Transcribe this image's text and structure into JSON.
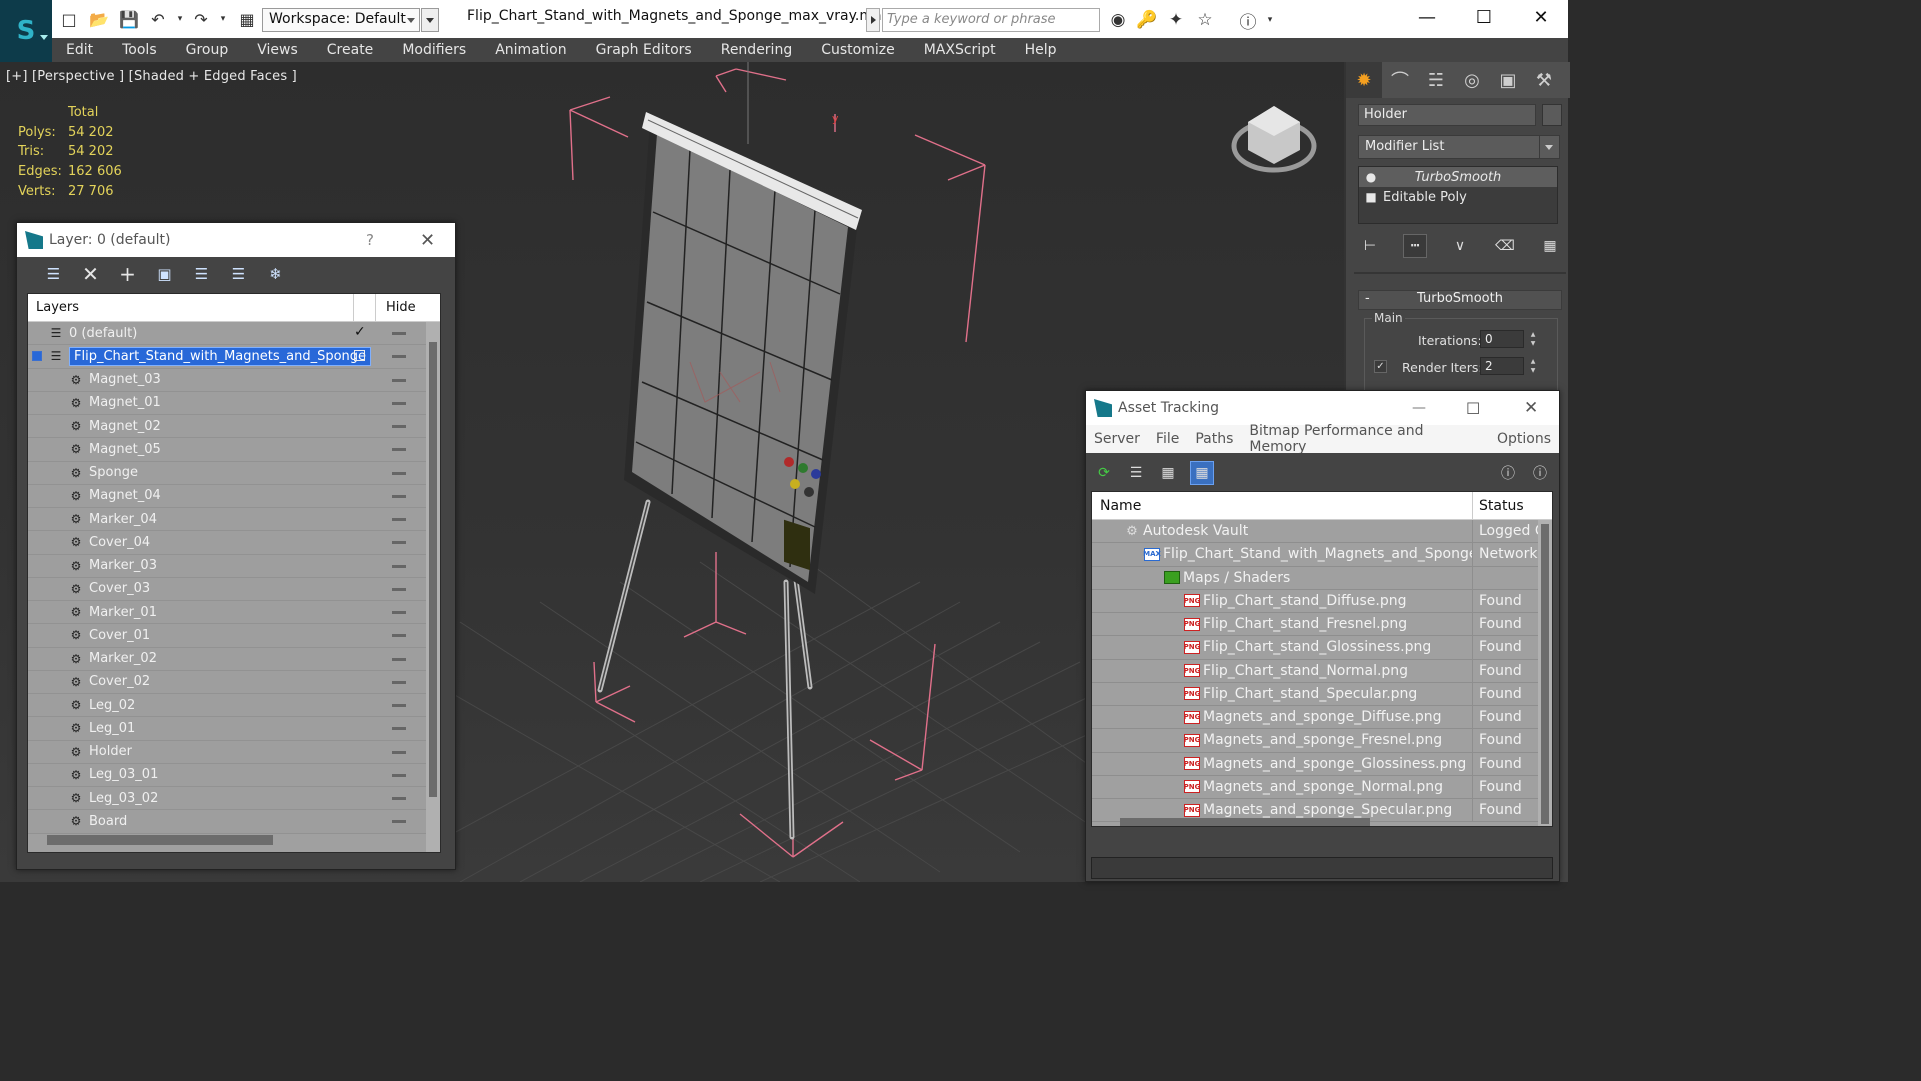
{
  "app": {
    "workspace": "Workspace: Default",
    "document_title": "Flip_Chart_Stand_with_Magnets_and_Sponge_max_vray.max",
    "search_placeholder": "Type a keyword or phrase"
  },
  "menu": [
    "Edit",
    "Tools",
    "Group",
    "Views",
    "Create",
    "Modifiers",
    "Animation",
    "Graph Editors",
    "Rendering",
    "Customize",
    "MAXScript",
    "Help"
  ],
  "viewport": {
    "label": "[+] [Perspective ] [Shaded + Edged Faces ]",
    "stats_header": "Total",
    "stats": [
      {
        "k": "Polys:",
        "v": "54 202"
      },
      {
        "k": "Tris:",
        "v": "54 202"
      },
      {
        "k": "Edges:",
        "v": "162 606"
      },
      {
        "k": "Verts:",
        "v": "27 706"
      }
    ]
  },
  "command_panel": {
    "object_name": "Holder",
    "modifier_list": "Modifier List",
    "stack": [
      "TurboSmooth",
      "Editable Poly"
    ],
    "rollout_title": "TurboSmooth",
    "group_label": "Main",
    "iterations_label": "Iterations:",
    "iterations_value": "0",
    "render_iters_label": "Render Iters:",
    "render_iters_value": "2"
  },
  "layer_window": {
    "title": "Layer: 0 (default)",
    "help": "?",
    "col_layers": "Layers",
    "col_hide": "Hide",
    "default_layer": "0 (default)",
    "selected_layer": "Flip_Chart_Stand_with_Magnets_and_Sponge",
    "objects": [
      "Magnet_03",
      "Magnet_01",
      "Magnet_02",
      "Magnet_05",
      "Sponge",
      "Magnet_04",
      "Marker_04",
      "Cover_04",
      "Marker_03",
      "Cover_03",
      "Marker_01",
      "Cover_01",
      "Marker_02",
      "Cover_02",
      "Leg_02",
      "Leg_01",
      "Holder",
      "Leg_03_01",
      "Leg_03_02",
      "Board"
    ]
  },
  "asset_window": {
    "title": "Asset Tracking",
    "menu": [
      "Server",
      "File",
      "Paths",
      "Bitmap Performance and Memory",
      "Options"
    ],
    "col_name": "Name",
    "col_status": "Status",
    "rows": [
      {
        "name": "Autodesk Vault",
        "status": "Logged O",
        "type": "vault",
        "depth": 1
      },
      {
        "name": "Flip_Chart_Stand_with_Magnets_and_Sponge_...",
        "status": "Network",
        "type": "max",
        "depth": 2
      },
      {
        "name": "Maps / Shaders",
        "status": "",
        "type": "maps",
        "depth": 3
      },
      {
        "name": "Flip_Chart_stand_Diffuse.png",
        "status": "Found",
        "type": "png",
        "depth": 4
      },
      {
        "name": "Flip_Chart_stand_Fresnel.png",
        "status": "Found",
        "type": "png",
        "depth": 4
      },
      {
        "name": "Flip_Chart_stand_Glossiness.png",
        "status": "Found",
        "type": "png",
        "depth": 4
      },
      {
        "name": "Flip_Chart_stand_Normal.png",
        "status": "Found",
        "type": "png",
        "depth": 4
      },
      {
        "name": "Flip_Chart_stand_Specular.png",
        "status": "Found",
        "type": "png",
        "depth": 4
      },
      {
        "name": "Magnets_and_sponge_Diffuse.png",
        "status": "Found",
        "type": "png",
        "depth": 4
      },
      {
        "name": "Magnets_and_sponge_Fresnel.png",
        "status": "Found",
        "type": "png",
        "depth": 4
      },
      {
        "name": "Magnets_and_sponge_Glossiness.png",
        "status": "Found",
        "type": "png",
        "depth": 4
      },
      {
        "name": "Magnets_and_sponge_Normal.png",
        "status": "Found",
        "type": "png",
        "depth": 4
      },
      {
        "name": "Magnets_and_sponge_Specular.png",
        "status": "Found",
        "type": "png",
        "depth": 4
      }
    ]
  },
  "colors": {
    "accent_blue": "#2868d8",
    "stats_yellow": "#e3d35a",
    "bbox_pink": "#e0708a"
  }
}
